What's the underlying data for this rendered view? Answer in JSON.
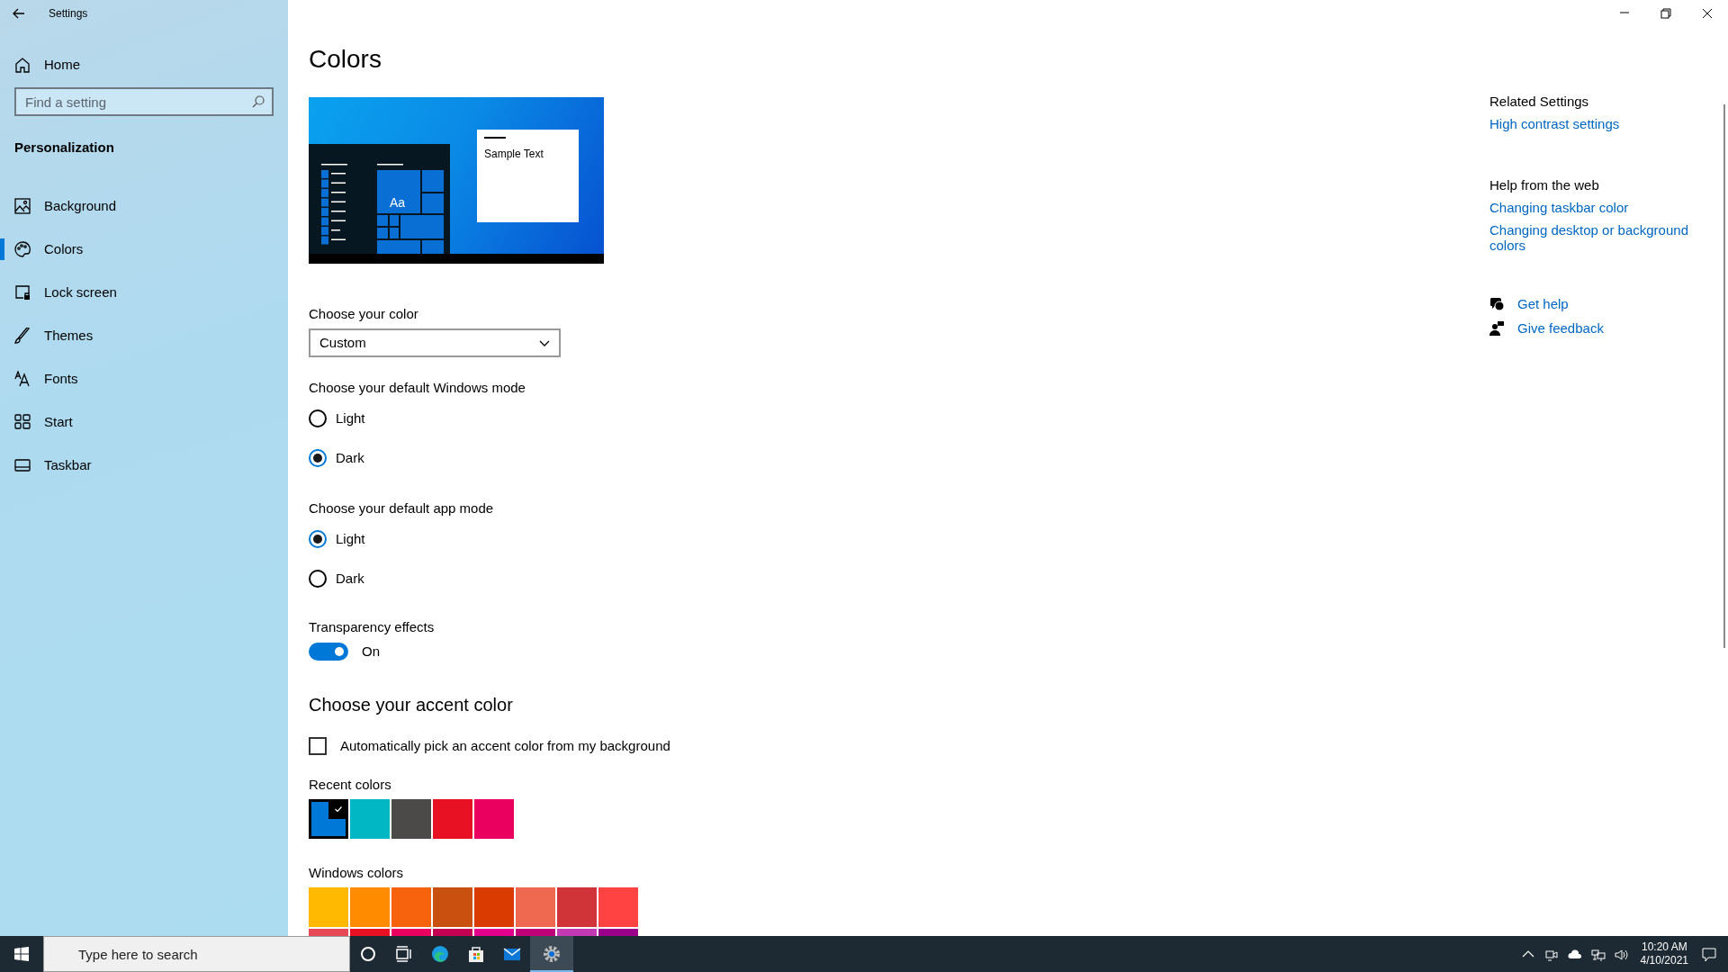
{
  "window": {
    "title": "Settings"
  },
  "sidebar": {
    "home": "Home",
    "search": {
      "placeholder": "Find a setting"
    },
    "section": "Personalization",
    "items": [
      {
        "label": "Background",
        "selected": false
      },
      {
        "label": "Colors",
        "selected": true
      },
      {
        "label": "Lock screen",
        "selected": false
      },
      {
        "label": "Themes",
        "selected": false
      },
      {
        "label": "Fonts",
        "selected": false
      },
      {
        "label": "Start",
        "selected": false
      },
      {
        "label": "Taskbar",
        "selected": false
      }
    ]
  },
  "content": {
    "title": "Colors",
    "preview": {
      "tile_text": "Aa",
      "sample_text": "Sample Text"
    },
    "color_choice": {
      "label": "Choose your color",
      "value": "Custom"
    },
    "windows_mode": {
      "label": "Choose your default Windows mode",
      "options": [
        {
          "label": "Light",
          "selected": false
        },
        {
          "label": "Dark",
          "selected": true
        }
      ]
    },
    "app_mode": {
      "label": "Choose your default app mode",
      "options": [
        {
          "label": "Light",
          "selected": true
        },
        {
          "label": "Dark",
          "selected": false
        }
      ]
    },
    "transparency": {
      "label": "Transparency effects",
      "on": true,
      "state_text": "On"
    },
    "accent": {
      "title": "Choose your accent color",
      "auto_pick": {
        "label": "Automatically pick an accent color from my background",
        "checked": false
      },
      "recent": {
        "label": "Recent colors",
        "swatches": [
          {
            "color": "#0078d7",
            "selected": true
          },
          {
            "color": "#00b7c3",
            "selected": false
          },
          {
            "color": "#4c4a48",
            "selected": false
          },
          {
            "color": "#e81123",
            "selected": false
          },
          {
            "color": "#ea005e",
            "selected": false
          }
        ]
      },
      "windows": {
        "label": "Windows colors",
        "swatches": [
          {
            "color": "#ffb900",
            "selected": false
          },
          {
            "color": "#ff8c00",
            "selected": false
          },
          {
            "color": "#f7630c",
            "selected": false
          },
          {
            "color": "#ca5010",
            "selected": false
          },
          {
            "color": "#da3b01",
            "selected": false
          },
          {
            "color": "#ef6950",
            "selected": false
          },
          {
            "color": "#d13438",
            "selected": false
          },
          {
            "color": "#ff4343",
            "selected": false
          },
          {
            "color": "#e74856",
            "selected": false
          },
          {
            "color": "#e81123",
            "selected": false
          },
          {
            "color": "#ea005e",
            "selected": false
          },
          {
            "color": "#c30052",
            "selected": false
          },
          {
            "color": "#e3008c",
            "selected": false
          },
          {
            "color": "#bf0077",
            "selected": false
          },
          {
            "color": "#c239b3",
            "selected": false
          },
          {
            "color": "#9a0089",
            "selected": false
          }
        ]
      }
    }
  },
  "related": {
    "title": "Related Settings",
    "links": [
      "High contrast settings"
    ]
  },
  "help": {
    "title": "Help from the web",
    "links": [
      "Changing taskbar color",
      "Changing desktop or background colors"
    ]
  },
  "support": [
    {
      "kind": "help",
      "label": "Get help"
    },
    {
      "kind": "feedback",
      "label": "Give feedback"
    }
  ],
  "taskbar": {
    "search": {
      "placeholder": "Type here to search"
    },
    "apps": [
      {
        "kind": "cortana",
        "active": false
      },
      {
        "kind": "taskview",
        "active": false
      },
      {
        "kind": "edge",
        "active": false
      },
      {
        "kind": "store",
        "active": false
      },
      {
        "kind": "mail",
        "active": false
      },
      {
        "kind": "settings",
        "active": true
      }
    ],
    "clock": {
      "time": "10:20 AM",
      "date": "4/10/2021"
    }
  }
}
